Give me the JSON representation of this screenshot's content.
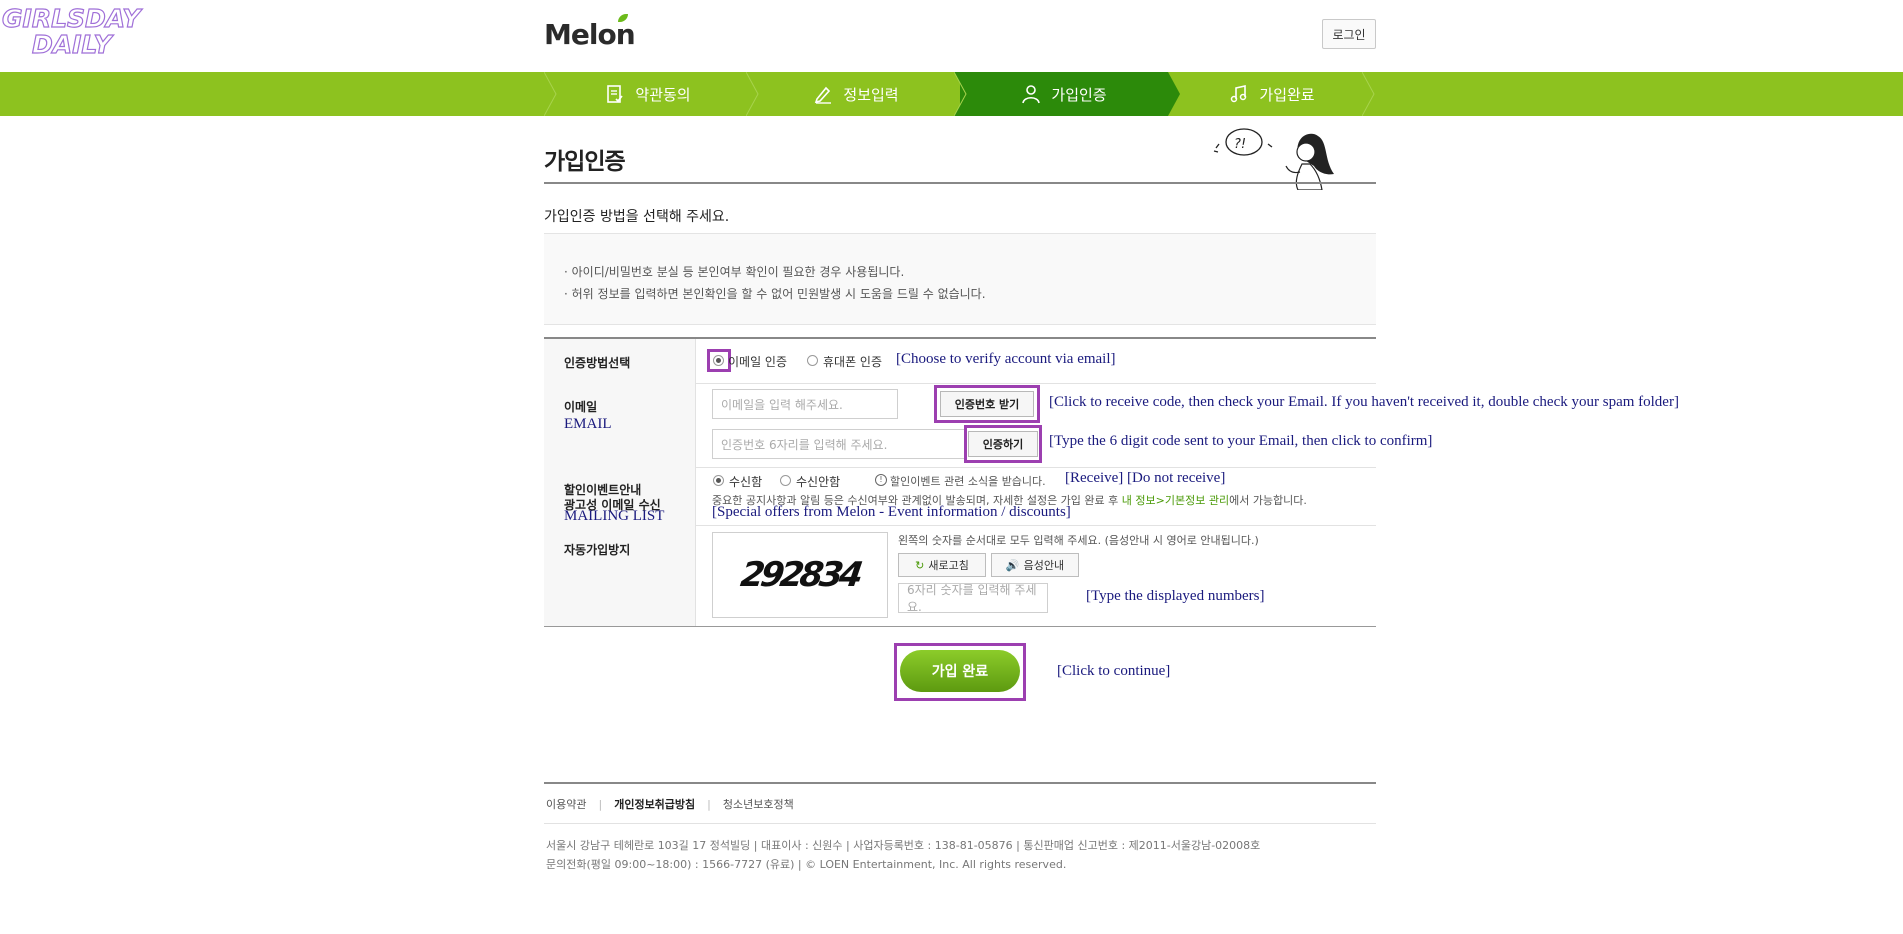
{
  "watermark": {
    "line1": "GIRLSDAY",
    "line2": "DAILY"
  },
  "header": {
    "logo": "Melon",
    "login_label": "로그인"
  },
  "steps": [
    {
      "label": "약관동의",
      "icon": "document-check-icon",
      "active": false
    },
    {
      "label": "정보입력",
      "icon": "pencil-icon",
      "active": false
    },
    {
      "label": "가입인증",
      "icon": "person-icon",
      "active": true
    },
    {
      "label": "가입완료",
      "icon": "music-note-icon",
      "active": false
    }
  ],
  "page": {
    "title": "가입인증",
    "description": "가입인증 방법을 선택해 주세요.",
    "notices": [
      "· 아이디/비밀번호 분실 등 본인여부 확인이 필요한 경우 사용됩니다.",
      "· 허위 정보를 입력하면 본인확인을 할 수 없어 민원발생 시 도움을 드릴 수 없습니다."
    ]
  },
  "form": {
    "method": {
      "label": "인증방법선택",
      "option_email": "이메일 인증",
      "option_phone": "휴대폰 인증",
      "selected": "email",
      "annotation": "[Choose to verify account via email]"
    },
    "email": {
      "label": "이메일",
      "label_en": "EMAIL",
      "email_placeholder": "이메일을 입력 해주세요.",
      "get_code_button": "인증번호 받기",
      "get_code_annotation": "[Click to receive code, then check your Email. If you haven't received it, double check your spam folder]",
      "code_placeholder": "인증번호 6자리를 입력해 주세요.",
      "verify_button": "인증하기",
      "verify_annotation": "[Type the 6 digit code sent to your Email, then click to confirm]"
    },
    "mailing": {
      "label_line1": "할인이벤트안내",
      "label_line2": "광고성 이메일 수신",
      "label_en": "MAILING LIST",
      "option_receive": "수신함",
      "option_reject": "수신안함",
      "selected": "receive",
      "info": "할인이벤트 관련 소식을 받습니다.",
      "annotation": "[Receive] [Do not receive]",
      "note_prefix": "중요한 공지사항과 알림 등은 수신여부와 관계없이 발송되며, 자세한 설정은 가입 완료 후",
      "note_link": "내 정보>기본정보 관리",
      "note_suffix": "에서 가능합니다.",
      "note_annotation": "[Special offers from Melon - Event information / discounts]"
    },
    "captcha": {
      "label": "자동가입방지",
      "image_text": "292834",
      "instruction": "왼쪽의 숫자를 순서대로 모두 입력해 주세요. (음성안내 시 영어로 안내됩니다.)",
      "refresh_button": "새로고침",
      "audio_button": "음성안내",
      "input_placeholder": "6자리 숫자를 입력해 주세요.",
      "annotation": "[Type the displayed numbers]"
    }
  },
  "submit": {
    "label": "가입 완료",
    "annotation": "[Click to continue]"
  },
  "footer": {
    "links": [
      "이용약관",
      "개인정보취급방침",
      "청소년보호정책"
    ],
    "address_line1": "서울시 강남구 테헤란로 103길 17 정석빌딩  |  대표이사 : 신원수  |  사업자등록번호 : 138-81-05876  |  통신판매업 신고번호 : 제2011-서울강남-02008호",
    "address_line2": "문의전화(평일 09:00~18:00) : 1566-7727 (유료)  |  © LOEN Entertainment, Inc. All rights reserved."
  },
  "colors": {
    "brand_green": "#8dc21f",
    "active_step": "#2c8a0a",
    "annotation": "#1a1a7e",
    "highlight": "#9c3fb0"
  }
}
